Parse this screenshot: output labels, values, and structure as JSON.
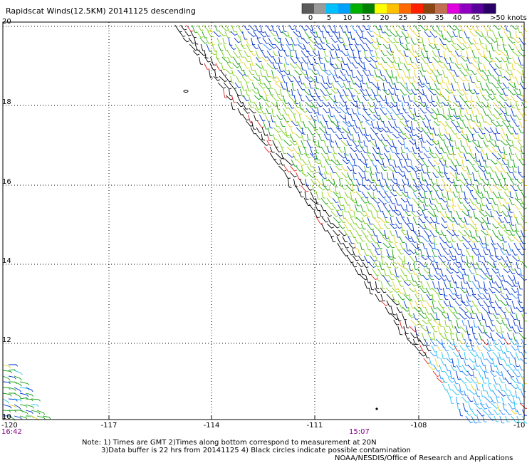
{
  "title": "Rapidscat Winds(12.5KM) 20141125 descending",
  "colorbar": {
    "colors": [
      "#5a5a5a",
      "#9a9a9a",
      "#00c0ff",
      "#00a0ff",
      "#00b000",
      "#008000",
      "#ffff00",
      "#ffc000",
      "#ff6a00",
      "#ff2000",
      "#8b4513",
      "#c07050",
      "#e000e0",
      "#9000c0",
      "#5a009a",
      "#2a0066"
    ],
    "labels": [
      "0",
      "5",
      "10",
      "15",
      "20",
      "25",
      "30",
      "35",
      "40",
      "45",
      ">50 knots"
    ]
  },
  "axes": {
    "y_ticks": [
      "20",
      "18",
      "16",
      "14",
      "12",
      "10"
    ],
    "x_ticks": [
      "-120",
      "-117",
      "-114",
      "-111",
      "-108",
      "-10"
    ]
  },
  "times": [
    "16:42",
    "15:07"
  ],
  "notes": [
    "Note: 1) Times are GMT 2)Times along bottom correspond to measurement at 20N",
    "3)Data buffer is 22 hrs from 20141125 4) Black circles indicate possible contamination",
    "NOAA/NESDIS/Office of Research and Applications"
  ],
  "wind_colors": {
    "blue": "#0033cc",
    "light_blue": "#2a8cff",
    "cyan": "#27c2f0",
    "green": "#14a014",
    "light_green": "#7ccd1a",
    "yellow": "#e6d22a",
    "orange": "#e87a14",
    "red": "#e02020",
    "black": "#000000"
  }
}
